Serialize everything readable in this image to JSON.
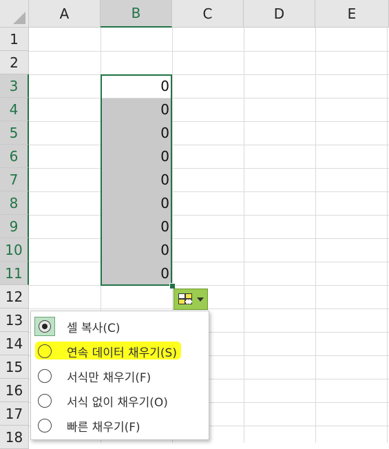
{
  "columns": [
    "A",
    "B",
    "C",
    "D",
    "E"
  ],
  "rows": [
    "1",
    "2",
    "3",
    "4",
    "5",
    "6",
    "7",
    "8",
    "9",
    "10",
    "11",
    "12",
    "13",
    "14",
    "15",
    "16",
    "17",
    "18"
  ],
  "cells": [
    "0",
    "0",
    "0",
    "0",
    "0",
    "0",
    "0",
    "0",
    "0"
  ],
  "autofill_menu": {
    "items": [
      {
        "label": "셀 복사(C)",
        "selected": true
      },
      {
        "label": "연속 데이터 채우기(S)",
        "selected": false,
        "highlighted": true
      },
      {
        "label": "서식만 채우기(F)",
        "selected": false
      },
      {
        "label": "서식 없이 채우기(O)",
        "selected": false
      },
      {
        "label": "빠른 채우기(F)",
        "selected": false
      }
    ]
  },
  "colors": {
    "selection": "#217346",
    "fill_gray": "#c9c9c9",
    "autofill_button": "#9bcb50",
    "highlight": "#ffff1e"
  }
}
